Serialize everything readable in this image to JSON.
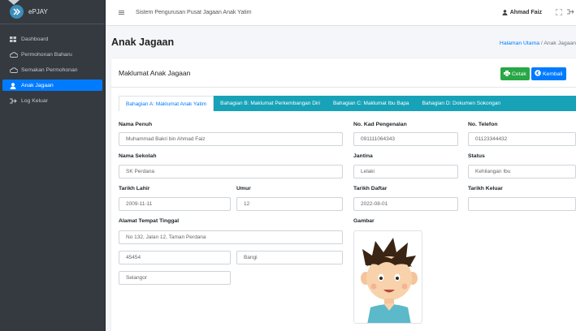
{
  "brand": {
    "name": "ePJAY"
  },
  "sidebar": {
    "items": [
      {
        "label": "Dashboard",
        "icon": "dashboard-grid-icon"
      },
      {
        "label": "Permohonan Baharu",
        "icon": "cloud-icon"
      },
      {
        "label": "Semakan Permohonan",
        "icon": "cloud-icon"
      },
      {
        "label": "Anak Jagaan",
        "icon": "user-icon"
      },
      {
        "label": "Log Keluar",
        "icon": "sign-out-icon"
      }
    ]
  },
  "header": {
    "title": "Sistem Pengurusan Pusat Jagaan Anak Yatim",
    "user": "Ahmad Faiz"
  },
  "page": {
    "title": "Anak Jagaan",
    "breadcrumb_home": "Halaman Utama",
    "breadcrumb_sep": "/",
    "breadcrumb_current": "Anak Jagaan"
  },
  "card": {
    "title": "Maklumat Anak Jagaan",
    "cetak_label": "Cetak",
    "kembali_label": "Kembali"
  },
  "tabs": [
    "Bahagian A: Maklumat Anak Yatim",
    "Bahagian B: Maklumat Perkembangan Diri",
    "Bahagian C: Maklumat Ibu Bapa",
    "Bahagian D: Dokumen Sokongan"
  ],
  "form": {
    "nama_penuh": {
      "label": "Nama Penuh",
      "value": "Muhammad Bakri bin Ahmad Faiz"
    },
    "no_kp": {
      "label": "No. Kad Pengenalan",
      "value": "091111064343"
    },
    "no_tel": {
      "label": "No. Telefon",
      "value": "01123344432"
    },
    "nama_sekolah": {
      "label": "Nama Sekolah",
      "value": "SK Perdana"
    },
    "jantina": {
      "label": "Jantina",
      "value": "Lelaki"
    },
    "status": {
      "label": "Status",
      "value": "Kehilangan Ibu"
    },
    "tarikh_lahir": {
      "label": "Tarikh Lahir",
      "value": "2009-11-11"
    },
    "umur": {
      "label": "Umur",
      "value": "12"
    },
    "tarikh_daftar": {
      "label": "Tarikh Daftar",
      "value": "2022-08-01"
    },
    "tarikh_keluar": {
      "label": "Tarikh Keluar",
      "value": ""
    },
    "alamat": {
      "label": "Alamat Tempat Tinggal",
      "line1": "No 132, Jalan 12, Taman Perdana",
      "poskod": "45454",
      "bandar": "Bangi",
      "negeri": "Selangor"
    },
    "gambar": {
      "label": "Gambar"
    }
  },
  "colors": {
    "sidebar_bg": "#343a40",
    "primary": "#007bff",
    "success": "#28a745",
    "tab_bar": "#17a2b8"
  }
}
